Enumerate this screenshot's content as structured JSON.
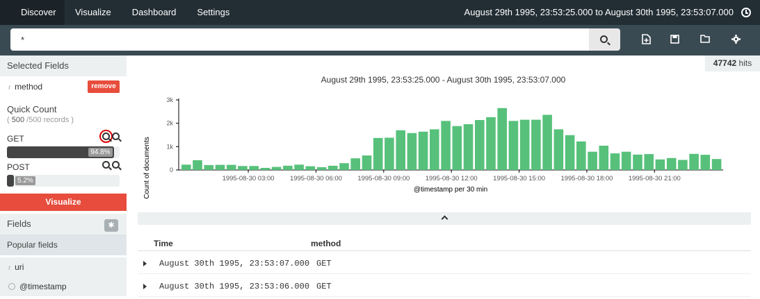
{
  "nav": {
    "tabs": [
      {
        "label": "Discover"
      },
      {
        "label": "Visualize"
      },
      {
        "label": "Dashboard"
      },
      {
        "label": "Settings"
      }
    ],
    "time_range": "August 29th 1995, 23:53:25.000 to August 30th 1995, 23:53:07.000"
  },
  "search": {
    "query": "*"
  },
  "sidebar": {
    "selected_fields_title": "Selected Fields",
    "selected_field": {
      "type_icon": "t",
      "name": "method",
      "remove_label": "remove"
    },
    "quick_count": {
      "title": "Quick Count",
      "sub_open": "( ",
      "count": "500",
      "sub_rest": " /500 records )",
      "terms": [
        {
          "label": "GET",
          "pct_label": "94.8%",
          "pct": 94.8
        },
        {
          "label": "POST",
          "pct_label": "5.2%",
          "pct": 5.2
        }
      ]
    },
    "visualize_label": "Visualize",
    "fields_title": "Fields",
    "popular_title": "Popular fields",
    "popular": [
      {
        "type_icon": "t",
        "name": "uri"
      },
      {
        "type_icon": "clock",
        "name": "@timestamp"
      }
    ]
  },
  "main": {
    "hits_count": "47742",
    "hits_label": "hits",
    "table": {
      "headers": [
        "Time",
        "method"
      ],
      "rows": [
        {
          "time": "August 30th 1995, 23:53:07.000",
          "method": "GET"
        },
        {
          "time": "August 30th 1995, 23:53:06.000",
          "method": "GET"
        }
      ]
    }
  },
  "chart_data": {
    "type": "bar",
    "title": "August 29th 1995, 23:53:25.000 - August 30th 1995, 23:53:07.000",
    "xlabel": "@timestamp per 30 min",
    "ylabel": "Count of documents",
    "ylim": [
      0,
      3000
    ],
    "yticks": [
      "0",
      "1k",
      "2k",
      "3k"
    ],
    "xticks": [
      "1995-08-30 03:00",
      "1995-08-30 06:00",
      "1995-08-30 09:00",
      "1995-08-30 12:00",
      "1995-08-30 15:00",
      "1995-08-30 18:00",
      "1995-08-30 21:00"
    ],
    "bar_color": "#57c17b",
    "values": [
      230,
      420,
      210,
      220,
      220,
      170,
      170,
      90,
      130,
      180,
      230,
      160,
      120,
      180,
      290,
      500,
      620,
      1370,
      1380,
      1700,
      1580,
      1640,
      1740,
      2100,
      1880,
      1960,
      2140,
      2260,
      2650,
      2100,
      2150,
      2150,
      2360,
      1740,
      1490,
      1220,
      780,
      1040,
      710,
      780,
      660,
      680,
      450,
      510,
      430,
      690,
      650,
      470
    ]
  }
}
